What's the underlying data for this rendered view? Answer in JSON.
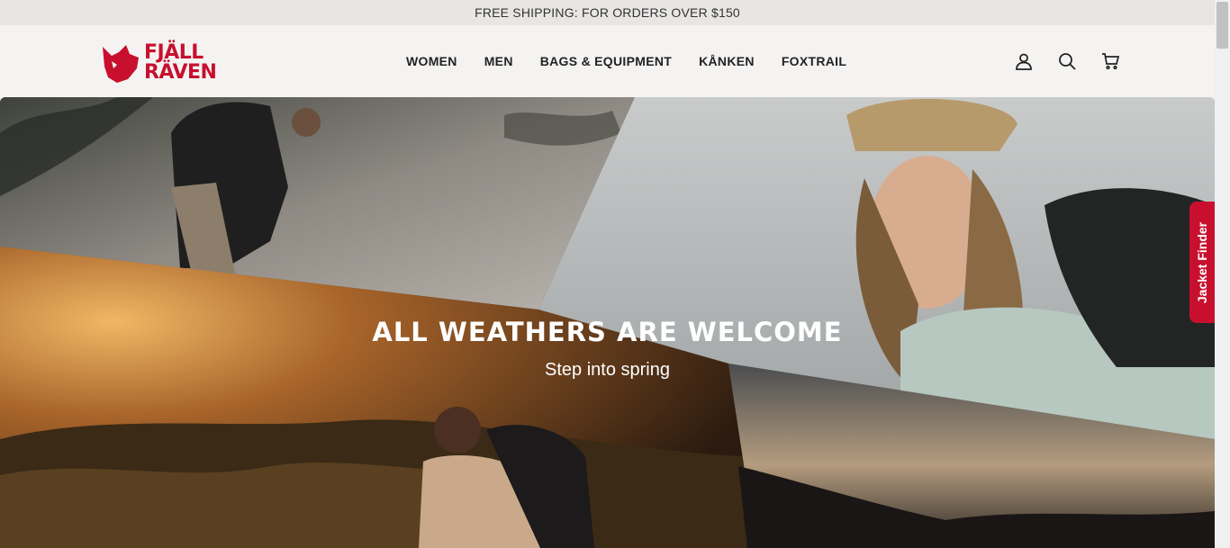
{
  "announcement": {
    "text": "FREE SHIPPING: FOR ORDERS OVER $150"
  },
  "header": {
    "logo": {
      "line1": "FJÄLL",
      "line2": "RÄVEN"
    },
    "nav": [
      {
        "label": "WOMEN"
      },
      {
        "label": "MEN"
      },
      {
        "label": "BAGS & EQUIPMENT"
      },
      {
        "label": "KÅNKEN"
      },
      {
        "label": "FOXTRAIL"
      }
    ],
    "icons": [
      "account-icon",
      "search-icon",
      "cart-icon"
    ]
  },
  "hero": {
    "title": "ALL WEATHERS ARE WELCOME",
    "subtitle": "Step into spring"
  },
  "jacket_finder": {
    "label": "Jacket Finder"
  },
  "colors": {
    "brand": "#c8102e",
    "background": "#f4f3f2",
    "announce_bg": "#e8e6e4"
  }
}
